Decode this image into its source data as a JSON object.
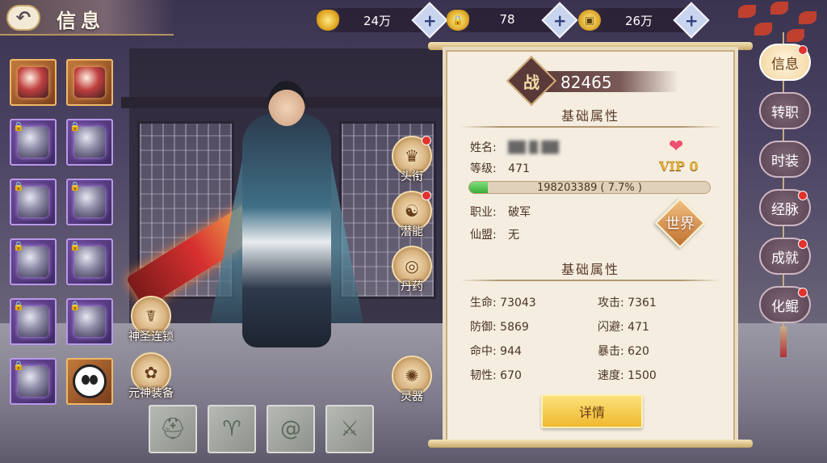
{
  "header": {
    "title": "信息",
    "back_icon": "back-arrow-icon"
  },
  "currencies": [
    {
      "icon": "gold-ingot-icon",
      "value": "24万"
    },
    {
      "icon": "bound-ingot-icon",
      "value": "78"
    },
    {
      "icon": "copper-coin-icon",
      "value": "26万"
    }
  ],
  "equipment": {
    "rarity_colors": {
      "orange": "#c27a3c",
      "purple": "#6d4a9c"
    }
  },
  "side_buttons_left": [
    {
      "label": "神圣连锁",
      "icon": "holy-chain-icon"
    },
    {
      "label": "元神装备",
      "icon": "spirit-gear-icon"
    }
  ],
  "side_buttons_right": [
    {
      "label": "头衔",
      "icon": "medal-icon",
      "badge": true
    },
    {
      "label": "潜能",
      "icon": "yin-yang-icon",
      "badge": true
    },
    {
      "label": "丹药",
      "icon": "pill-swirl-icon",
      "badge": false
    },
    {
      "label": "灵器",
      "icon": "spirit-wheel-icon",
      "badge": true
    }
  ],
  "bottom_slots": [
    {
      "icon": "helmet-icon"
    },
    {
      "icon": "gourd-icon"
    },
    {
      "icon": "scroll-swirl-icon"
    },
    {
      "icon": "armor-piece-icon"
    }
  ],
  "panel": {
    "power_label": "战",
    "power_value": "82465",
    "section1_title": "基础属性",
    "name_label": "姓名:",
    "name_value": "██ █ ██",
    "level_label": "等级:",
    "level_value": "471",
    "exp_text": "198203389 ( 7.7% )",
    "exp_fraction": 0.077,
    "vip_text": "VIP 0",
    "job_label": "职业:",
    "job_value": "破军",
    "guild_label": "仙盟:",
    "guild_value": "无",
    "world_label": "世界",
    "section2_title": "基础属性",
    "stats_left": [
      {
        "label": "生命:",
        "value": "73043"
      },
      {
        "label": "防御:",
        "value": "5869"
      },
      {
        "label": "命中:",
        "value": "944"
      },
      {
        "label": "韧性:",
        "value": "670"
      }
    ],
    "stats_right": [
      {
        "label": "攻击:",
        "value": "7361"
      },
      {
        "label": "闪避:",
        "value": "471"
      },
      {
        "label": "暴击:",
        "value": "620"
      },
      {
        "label": "速度:",
        "value": "1500"
      }
    ],
    "detail_button": "详情"
  },
  "tabs": [
    {
      "label": "信息",
      "active": true,
      "badge": true
    },
    {
      "label": "转职",
      "active": false,
      "badge": false
    },
    {
      "label": "时装",
      "active": false,
      "badge": false
    },
    {
      "label": "经脉",
      "active": false,
      "badge": true
    },
    {
      "label": "成就",
      "active": false,
      "badge": true
    },
    {
      "label": "化鲲",
      "active": false,
      "badge": true
    }
  ]
}
